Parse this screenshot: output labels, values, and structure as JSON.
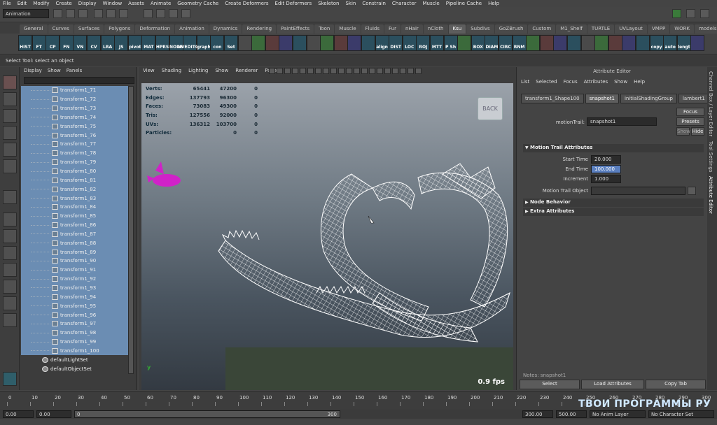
{
  "menubar": [
    "File",
    "Edit",
    "Modify",
    "Create",
    "Display",
    "Window",
    "Assets",
    "Animate",
    "Geometry Cache",
    "Create Deformers",
    "Edit Deformers",
    "Skeleton",
    "Skin",
    "Constrain",
    "Character",
    "Muscle",
    "Pipeline Cache",
    "Help"
  ],
  "status": {
    "mode": "Animation"
  },
  "shelf_tabs": [
    "General",
    "Curves",
    "Surfaces",
    "Polygons",
    "Deformation",
    "Animation",
    "Dynamics",
    "Rendering",
    "PaintEffects",
    "Toon",
    "Muscle",
    "Fluids",
    "Fur",
    "nHair",
    "nCloth",
    "Ksu",
    "Subdivs",
    "GoZBrush",
    "Custom",
    "M1_Shelf",
    "TURTLE",
    "UVLayout",
    "VMPP",
    "WORK",
    "models"
  ],
  "shelf_active": "Ksu",
  "shelf_items": [
    "HIST",
    "FT",
    "CP",
    "FN",
    "VN",
    "CV",
    "LRA",
    "JS",
    "pivot",
    "MAT",
    "HPRS",
    "NODE",
    "UVEDITOR",
    "graph",
    "con",
    "Set",
    "",
    "",
    "",
    "",
    "",
    "",
    "",
    "",
    "",
    "",
    "align",
    "DIST",
    "LOC",
    "ROJ",
    "MTT",
    "P Sh",
    "",
    "BOX",
    "DIAM",
    "CIRC",
    "RNM",
    "",
    "",
    "",
    "",
    "",
    "",
    "",
    "",
    "",
    "copy",
    "auto",
    "lengt",
    ""
  ],
  "helpline": "Select Tool: select an object",
  "outliner": {
    "menu": [
      "Display",
      "Show",
      "Panels"
    ],
    "items": [
      "transform1_71",
      "transform1_72",
      "transform1_73",
      "transform1_74",
      "transform1_75",
      "transform1_76",
      "transform1_77",
      "transform1_78",
      "transform1_79",
      "transform1_80",
      "transform1_81",
      "transform1_82",
      "transform1_83",
      "transform1_84",
      "transform1_85",
      "transform1_86",
      "transform1_87",
      "transform1_88",
      "transform1_89",
      "transform1_90",
      "transform1_91",
      "transform1_92",
      "transform1_93",
      "transform1_94",
      "transform1_95",
      "transform1_96",
      "transform1_97",
      "transform1_98",
      "transform1_99",
      "transform1_100"
    ],
    "sets": [
      "defaultLightSet",
      "defaultObjectSet"
    ]
  },
  "viewport": {
    "menu": [
      "View",
      "Shading",
      "Lighting",
      "Show",
      "Renderer",
      "Panels"
    ],
    "hud": [
      {
        "k": "Verts:",
        "a": "65441",
        "b": "47200",
        "c": "0"
      },
      {
        "k": "Edges:",
        "a": "137793",
        "b": "96300",
        "c": "0"
      },
      {
        "k": "Faces:",
        "a": "73083",
        "b": "49300",
        "c": "0"
      },
      {
        "k": "Tris:",
        "a": "127556",
        "b": "92000",
        "c": "0"
      },
      {
        "k": "UVs:",
        "a": "136312",
        "b": "103700",
        "c": "0"
      },
      {
        "k": "Particles:",
        "a": "",
        "b": "0",
        "c": "0"
      }
    ],
    "fps": "0.9 fps",
    "cube": "BACK",
    "axis_label": "y"
  },
  "attr_editor": {
    "title": "Attribute Editor",
    "menu": [
      "List",
      "Selected",
      "Focus",
      "Attributes",
      "Show",
      "Help"
    ],
    "tabs": [
      "transform1_Shape100",
      "snapshot1",
      "initialShadingGroup",
      "lambert1"
    ],
    "active_tab": "snapshot1",
    "node_label": "motionTrail:",
    "node_value": "snapshot1",
    "focus": "Focus",
    "presets": "Presets",
    "show": "Show",
    "hide": "Hide",
    "section1": "Motion Trail Attributes",
    "start_label": "Start Time",
    "start_value": "20.000",
    "end_label": "End Time",
    "end_value": "100.000",
    "inc_label": "Increment",
    "inc_value": "1.000",
    "mto_label": "Motion Trail Object",
    "section2": "Node Behavior",
    "section3": "Extra Attributes",
    "notes": "Notes: snapshot1",
    "select": "Select",
    "load": "Load Attributes",
    "copy": "Copy Tab"
  },
  "sidetabs": [
    "Channel Box / Layer Editor",
    "Tool Settings",
    "Attribute Editor"
  ],
  "timeline": {
    "labels": [
      "0",
      "10",
      "20",
      "30",
      "40",
      "50",
      "60",
      "70",
      "80",
      "90",
      "100",
      "110",
      "120",
      "130",
      "140",
      "150",
      "160",
      "170",
      "180",
      "190",
      "200",
      "210",
      "220",
      "230",
      "240",
      "250",
      "260",
      "270",
      "280",
      "290",
      "300"
    ]
  },
  "range": {
    "start": "0.00",
    "start2": "0.00",
    "current": "0",
    "end_in": "300",
    "end_a": "300.00",
    "end_b": "500.00",
    "anim_layer": "No Anim Layer",
    "char_set": "No Character Set"
  },
  "watermark": "ТВОИ ПРОГРАММЫ РУ",
  "colors": {
    "selection": "#6b8db3",
    "accent_pink": "#d022c8",
    "shelf_icon": "#2b4f5e"
  }
}
